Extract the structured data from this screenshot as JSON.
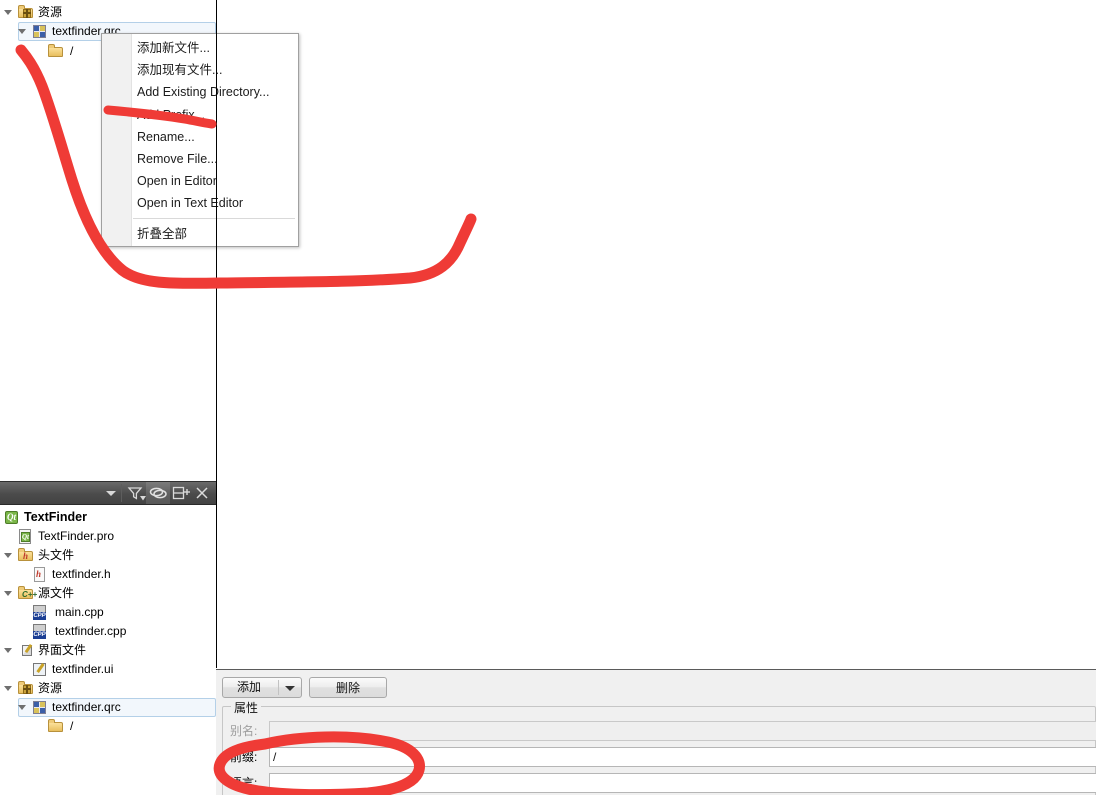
{
  "app": {
    "accent_red": "#ef3b36",
    "selection_blue": "#f2f7fc"
  },
  "resource_tree": {
    "items": [
      {
        "label": "资源",
        "icon": "resource-folder-icon",
        "indent": 0,
        "expanded": true,
        "selected": false
      },
      {
        "label": "textfinder.qrc",
        "icon": "qrc-file-icon",
        "indent": 1,
        "expanded": true,
        "selected": true
      },
      {
        "label": "/",
        "icon": "folder-icon",
        "indent": 2,
        "expanded": null,
        "selected": false
      }
    ]
  },
  "context_menu": {
    "items": [
      {
        "label": "添加新文件...",
        "separator_before": false
      },
      {
        "label": "添加现有文件...",
        "separator_before": false
      },
      {
        "label": "Add Existing Directory...",
        "separator_before": false
      },
      {
        "label": "Add Prefix...",
        "separator_before": false
      },
      {
        "label": "Rename...",
        "separator_before": false
      },
      {
        "label": "Remove File...",
        "separator_before": false
      },
      {
        "label": "Open in Editor",
        "separator_before": false
      },
      {
        "label": "Open in Text Editor",
        "separator_before": false
      },
      {
        "label": "折叠全部",
        "separator_before": true
      }
    ]
  },
  "project_toolbar": {
    "filter_name": "filter-icon",
    "sync_name": "link-with-editor-icon",
    "split_name": "split-view-icon",
    "close_name": "close-icon",
    "dropdown_name": "chevron-down-icon"
  },
  "project_tree": {
    "items": [
      {
        "label": "TextFinder",
        "icon": "qt-project-icon",
        "indent": 0,
        "expanded": null,
        "bold": true
      },
      {
        "label": "TextFinder.pro",
        "icon": "pro-file-icon",
        "indent": 1,
        "expanded": null,
        "bold": false
      },
      {
        "label": "头文件",
        "icon": "headers-folder-icon",
        "indent": 0,
        "expanded": true,
        "bold": false
      },
      {
        "label": "textfinder.h",
        "icon": "h-file-icon",
        "indent": 2,
        "expanded": null,
        "bold": false
      },
      {
        "label": "源文件",
        "icon": "sources-folder-icon",
        "indent": 0,
        "expanded": true,
        "bold": false
      },
      {
        "label": "main.cpp",
        "icon": "cpp-file-icon",
        "indent": 2,
        "expanded": null,
        "bold": false
      },
      {
        "label": "textfinder.cpp",
        "icon": "cpp-file-icon",
        "indent": 2,
        "expanded": null,
        "bold": false
      },
      {
        "label": "界面文件",
        "icon": "forms-folder-icon",
        "indent": 0,
        "expanded": true,
        "bold": false
      },
      {
        "label": "textfinder.ui",
        "icon": "ui-file-icon",
        "indent": 2,
        "expanded": null,
        "bold": false
      },
      {
        "label": "资源",
        "icon": "resource-folder-icon",
        "indent": 0,
        "expanded": true,
        "bold": false
      },
      {
        "label": "textfinder.qrc",
        "icon": "qrc-file-icon",
        "indent": 1,
        "expanded": true,
        "bold": false,
        "selected": true
      },
      {
        "label": "/",
        "icon": "folder-icon",
        "indent": 2,
        "expanded": null,
        "bold": false
      }
    ]
  },
  "properties_panel": {
    "add_button": "添加",
    "remove_button": "删除",
    "group_title": "属性",
    "fields": [
      {
        "label": "别名:",
        "value": "",
        "disabled": true
      },
      {
        "label": "前缀:",
        "value": "/",
        "disabled": false
      },
      {
        "label": "语言:",
        "value": "",
        "disabled": false
      }
    ]
  }
}
